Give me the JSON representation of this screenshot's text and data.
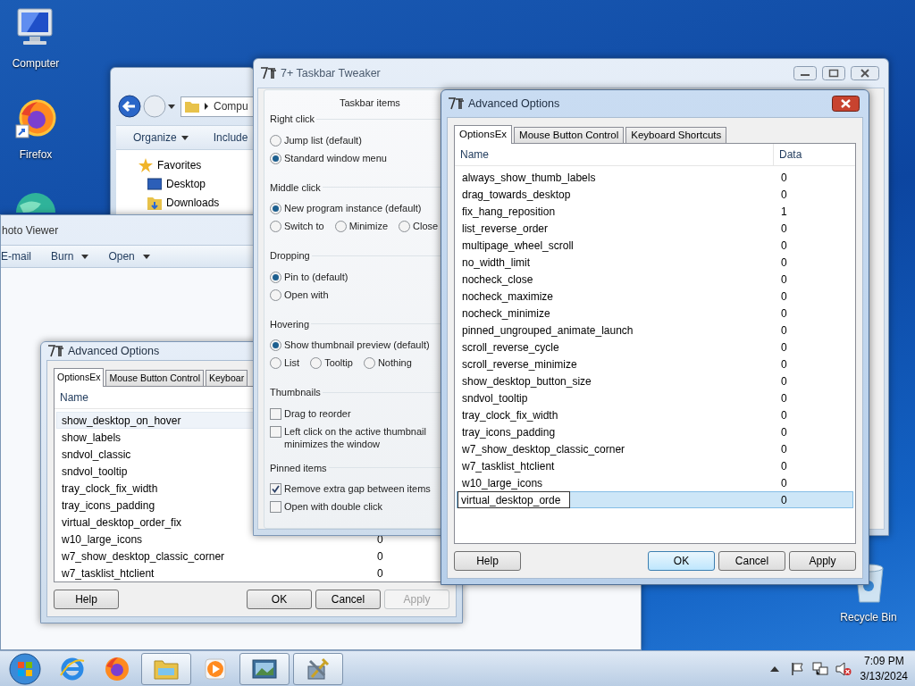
{
  "desktop_icons": [
    {
      "kind": "computer",
      "label": "Computer"
    },
    {
      "kind": "firefox",
      "label": "Firefox"
    },
    {
      "kind": "globe"
    },
    {
      "kind": "recycle",
      "label": "Recycle Bin"
    }
  ],
  "explorer": {
    "address": "Compu",
    "toolbar": [
      {
        "label": "Organize",
        "dropdown": true
      },
      {
        "label": "Include",
        "dropdown": false
      }
    ],
    "nav": [
      {
        "kind": "star",
        "label": "Favorites"
      },
      {
        "kind": "desktop",
        "label": "Desktop"
      },
      {
        "kind": "download",
        "label": "Downloads"
      }
    ]
  },
  "photo_viewer": {
    "title": "hoto Viewer",
    "toolbar": [
      {
        "label": "E-mail",
        "dropdown": false
      },
      {
        "label": "Burn",
        "dropdown": true
      },
      {
        "label": "Open",
        "dropdown": true
      }
    ]
  },
  "advanced_options_back": {
    "title": "Advanced Options",
    "tabs": [
      {
        "label": "OptionsEx",
        "selected": true
      },
      {
        "label": "Mouse Button Control",
        "selected": false
      },
      {
        "label": "Keyboar",
        "selected": false
      }
    ],
    "columns": [
      "Name"
    ],
    "rows": [
      {
        "kind": "item",
        "name": "show_desktop_on_hover",
        "selected": true
      },
      {
        "kind": "item",
        "name": "show_labels",
        "selected": false
      },
      {
        "kind": "item",
        "name": "sndvol_classic",
        "selected": false
      },
      {
        "kind": "item",
        "name": "sndvol_tooltip",
        "selected": false
      },
      {
        "kind": "item",
        "name": "tray_clock_fix_width",
        "selected": false
      },
      {
        "kind": "item",
        "name": "tray_icons_padding",
        "selected": false
      },
      {
        "kind": "item",
        "name": "virtual_desktop_order_fix",
        "selected": false
      },
      {
        "kind": "item",
        "name": "w10_large_icons",
        "data": "0",
        "selected": false
      },
      {
        "kind": "item",
        "name": "w7_show_desktop_classic_corner",
        "data": "0",
        "selected": false
      },
      {
        "kind": "item",
        "name": "w7_tasklist_htclient",
        "data": "0",
        "selected": false
      }
    ],
    "buttons": [
      {
        "label": "Help",
        "default": false,
        "disabled": false
      },
      {
        "label": "OK",
        "default": false,
        "disabled": false
      },
      {
        "label": "Cancel",
        "default": false,
        "disabled": false
      },
      {
        "label": "Apply",
        "default": false,
        "disabled": true
      }
    ]
  },
  "tweaker": {
    "title": "7+ Taskbar Tweaker",
    "group_title": "Taskbar items",
    "sections": [
      {
        "title": "Right click",
        "rows": [
          [
            {
              "kind": "radio",
              "label": "Jump list (default)",
              "checked": false
            }
          ],
          [
            {
              "kind": "radio",
              "label": "Standard window menu",
              "checked": true
            }
          ]
        ]
      },
      {
        "title": "Middle click",
        "rows": [
          [
            {
              "kind": "radio",
              "label": "New program instance (default)",
              "checked": true
            }
          ],
          [
            {
              "kind": "radio",
              "label": "Switch to",
              "checked": false
            },
            {
              "kind": "radio",
              "label": "Minimize",
              "checked": false
            },
            {
              "kind": "radio",
              "label": "Close",
              "checked": false
            }
          ]
        ]
      },
      {
        "title": "Dropping",
        "rows": [
          [
            {
              "kind": "radio",
              "label": "Pin to (default)",
              "checked": true
            }
          ],
          [
            {
              "kind": "radio",
              "label": "Open with",
              "checked": false
            }
          ]
        ]
      },
      {
        "title": "Hovering",
        "rows": [
          [
            {
              "kind": "radio",
              "label": "Show thumbnail preview (default)",
              "checked": true
            }
          ],
          [
            {
              "kind": "radio",
              "label": "List",
              "checked": false
            },
            {
              "kind": "radio",
              "label": "Tooltip",
              "checked": false
            },
            {
              "kind": "radio",
              "label": "Nothing",
              "checked": false
            }
          ]
        ]
      },
      {
        "title": "Thumbnails",
        "rows": [
          [
            {
              "kind": "checkbox",
              "label": "Drag to reorder",
              "checked": false
            }
          ],
          [
            {
              "kind": "checkbox",
              "label": "Left click on the active thumbnail minimizes the window",
              "checked": false
            }
          ]
        ]
      },
      {
        "title": "Pinned items",
        "rows": [
          [
            {
              "kind": "checkbox",
              "label": "Remove extra gap between items",
              "checked": true
            }
          ],
          [
            {
              "kind": "checkbox",
              "label": "Open with double click",
              "checked": false
            }
          ]
        ]
      }
    ]
  },
  "advanced_options_front": {
    "title": "Advanced Options",
    "tabs": [
      {
        "label": "OptionsEx",
        "selected": true
      },
      {
        "label": "Mouse Button Control",
        "selected": false
      },
      {
        "label": "Keyboard Shortcuts",
        "selected": false
      }
    ],
    "columns": [
      "Name",
      "Data"
    ],
    "rows": [
      {
        "kind": "item",
        "name": "always_show_thumb_labels",
        "data": "0",
        "selected": false
      },
      {
        "kind": "item",
        "name": "drag_towards_desktop",
        "data": "0",
        "selected": false
      },
      {
        "kind": "item",
        "name": "fix_hang_reposition",
        "data": "1",
        "selected": false
      },
      {
        "kind": "item",
        "name": "list_reverse_order",
        "data": "0",
        "selected": false
      },
      {
        "kind": "item",
        "name": "multipage_wheel_scroll",
        "data": "0",
        "selected": false
      },
      {
        "kind": "item",
        "name": "no_width_limit",
        "data": "0",
        "selected": false
      },
      {
        "kind": "item",
        "name": "nocheck_close",
        "data": "0",
        "selected": false
      },
      {
        "kind": "item",
        "name": "nocheck_maximize",
        "data": "0",
        "selected": false
      },
      {
        "kind": "item",
        "name": "nocheck_minimize",
        "data": "0",
        "selected": false
      },
      {
        "kind": "item",
        "name": "pinned_ungrouped_animate_launch",
        "data": "0",
        "selected": false
      },
      {
        "kind": "item",
        "name": "scroll_reverse_cycle",
        "data": "0",
        "selected": false
      },
      {
        "kind": "item",
        "name": "scroll_reverse_minimize",
        "data": "0",
        "selected": false
      },
      {
        "kind": "item",
        "name": "show_desktop_button_size",
        "data": "0",
        "selected": false
      },
      {
        "kind": "item",
        "name": "sndvol_tooltip",
        "data": "0",
        "selected": false
      },
      {
        "kind": "item",
        "name": "tray_clock_fix_width",
        "data": "0",
        "selected": false
      },
      {
        "kind": "item",
        "name": "tray_icons_padding",
        "data": "0",
        "selected": false
      },
      {
        "kind": "item",
        "name": "w7_show_desktop_classic_corner",
        "data": "0",
        "selected": false
      },
      {
        "kind": "item",
        "name": "w7_tasklist_htclient",
        "data": "0",
        "selected": false
      },
      {
        "kind": "item",
        "name": "w10_large_icons",
        "data": "0",
        "selected": false
      },
      {
        "kind": "edit",
        "name": "virtual_desktop_orde",
        "data": "0",
        "selected": true
      }
    ],
    "buttons": [
      {
        "label": "Help",
        "default": false,
        "disabled": false
      },
      {
        "label": "OK",
        "default": true,
        "disabled": false
      },
      {
        "label": "Cancel",
        "default": false,
        "disabled": false
      },
      {
        "label": "Apply",
        "default": false,
        "disabled": false
      }
    ]
  },
  "taskbar": {
    "apps": [
      {
        "kind": "ie",
        "running": false
      },
      {
        "kind": "firefox",
        "running": false
      },
      {
        "kind": "explorer",
        "running": true
      },
      {
        "kind": "media",
        "running": false
      },
      {
        "kind": "photo",
        "running": true
      },
      {
        "kind": "tools",
        "running": true
      }
    ],
    "time": "7:09 PM",
    "date": "3/13/2024"
  }
}
